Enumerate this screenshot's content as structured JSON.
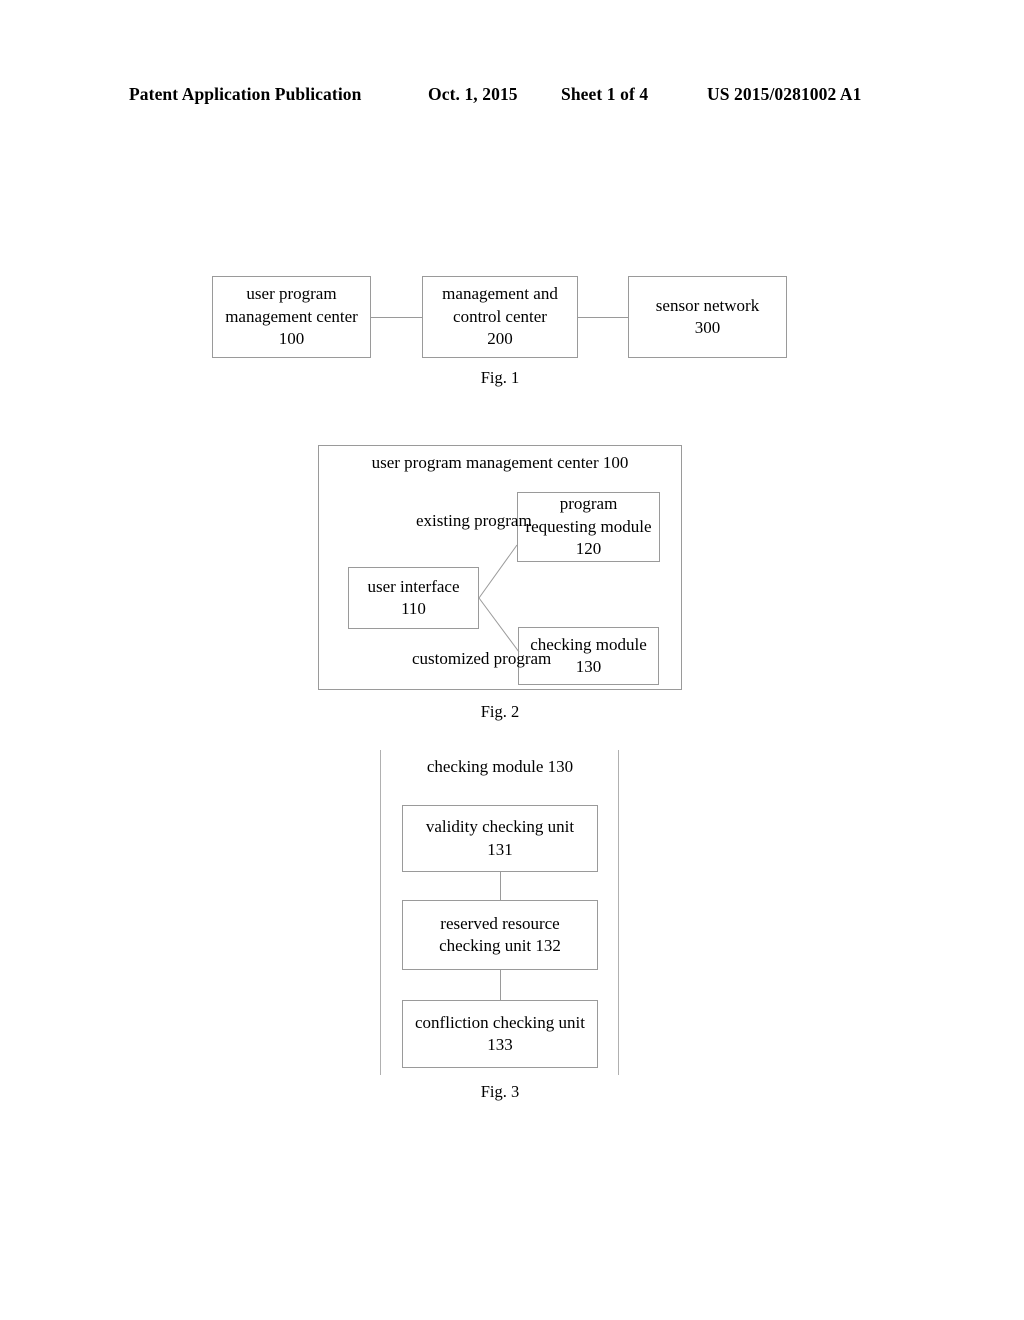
{
  "header": {
    "publication": "Patent Application Publication",
    "date": "Oct. 1, 2015",
    "sheet": "Sheet 1 of 4",
    "publication_number": "US 2015/0281002 A1"
  },
  "figures": [
    {
      "caption": "Fig. 1",
      "type": "block-diagram",
      "boxes": [
        {
          "line1": "user program",
          "line2": "management center",
          "line3": "100"
        },
        {
          "line1": "management and",
          "line2": "control center",
          "line3": "200"
        },
        {
          "line1": "sensor network",
          "line2": "300",
          "line3": ""
        }
      ]
    },
    {
      "caption": "Fig. 2",
      "type": "block-diagram",
      "container": {
        "line1": "user program management center",
        "line2": "100"
      },
      "boxes": [
        {
          "line1": "user interface",
          "line2": "110",
          "line3": ""
        },
        {
          "line1": "program",
          "line2": "requesting module",
          "line3": "120"
        },
        {
          "line1": "checking module",
          "line2": "130",
          "line3": ""
        }
      ],
      "edge_labels": [
        {
          "line1": "existing",
          "line2": "program"
        },
        {
          "line1": "customized",
          "line2": "program"
        }
      ]
    },
    {
      "caption": "Fig. 3",
      "type": "block-diagram",
      "container": {
        "line1": "checking module",
        "line2": "130"
      },
      "boxes": [
        {
          "line1": "validity checking unit",
          "line2": "131"
        },
        {
          "line1": "reserved resource",
          "line2": "checking unit 132"
        },
        {
          "line1": "confliction checking unit",
          "line2": "133"
        }
      ]
    }
  ],
  "colors": {
    "ink": "#000000",
    "line": "#9a9a9a",
    "page": "#ffffff"
  }
}
